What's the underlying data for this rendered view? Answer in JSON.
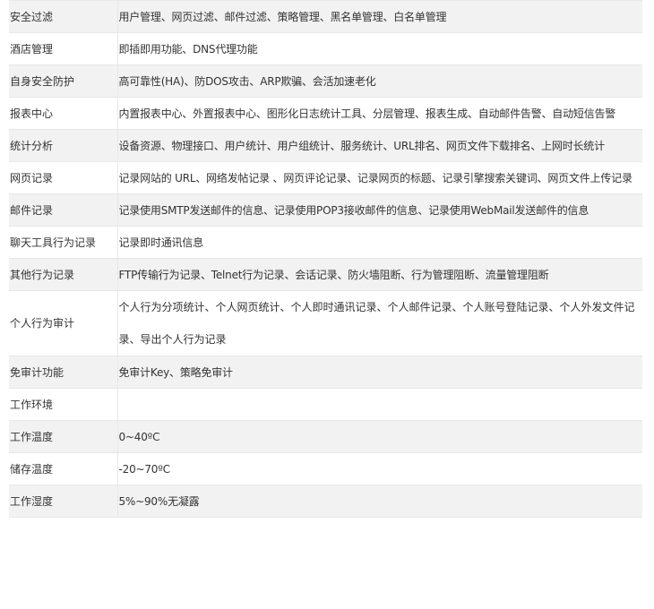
{
  "rows": [
    {
      "label": "安全过滤",
      "value": "用户管理、网页过滤、邮件过滤、策略管理、黑名单管理、白名单管理"
    },
    {
      "label": "酒店管理",
      "value": "即插即用功能、DNS代理功能"
    },
    {
      "label": "自身安全防护",
      "value": "高可靠性(HA)、防DOS攻击、ARP欺骗、会活加速老化"
    },
    {
      "label": "报表中心",
      "value": "内置报表中心、外置报表中心、图形化日志统计工具、分层管理、报表生成、自动邮件告警、自动短信告警"
    },
    {
      "label": "统计分析",
      "value": "设备资源、物理接口、用户统计、用户组统计、服务统计、URL排名、网页文件下载排名、上网时长统计"
    },
    {
      "label": "网页记录",
      "value": "记录网站的 URL、网络发帖记录 、网页评论记录、记录网页的标题、记录引擎搜索关键词、网页文件上传记录"
    },
    {
      "label": "邮件记录",
      "value": "记录使用SMTP发送邮件的信息、记录使用POP3接收邮件的信息、记录使用WebMail发送邮件的信息"
    },
    {
      "label": "聊天工具行为记录",
      "value": "记录即时通讯信息"
    },
    {
      "label": "其他行为记录",
      "value": "FTP传输行为记录、Telnet行为记录、会话记录、防火墙阻断、行为管理阻断、流量管理阻断"
    },
    {
      "label": "个人行为审计",
      "value": "个人行为分项统计、个人网页统计、个人即时通讯记录、个人邮件记录、个人账号登陆记录、个人外发文件记录、导出个人行为记录"
    },
    {
      "label": "免审计功能",
      "value": "免审计Key、策略免审计"
    },
    {
      "label": "工作环境",
      "value": ""
    },
    {
      "label": "工作温度",
      "value": "0~40ºC"
    },
    {
      "label": "储存温度",
      "value": "-20~70ºC"
    },
    {
      "label": "工作湿度",
      "value": "5%~90%无凝露"
    }
  ]
}
